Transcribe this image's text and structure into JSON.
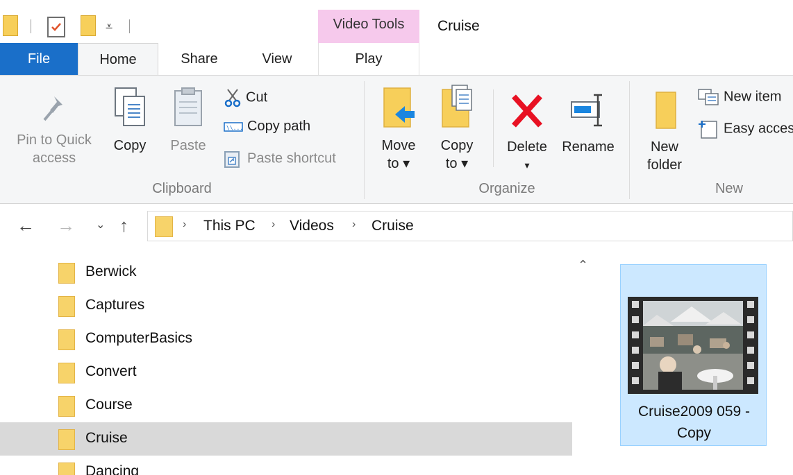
{
  "window": {
    "title": "Cruise",
    "contextual_tab_group": "Video Tools"
  },
  "tabs": {
    "file": "File",
    "home": "Home",
    "share": "Share",
    "view": "View",
    "play": "Play"
  },
  "ribbon": {
    "clipboard": {
      "label": "Clipboard",
      "pin_line1": "Pin to Quick",
      "pin_line2": "access",
      "copy": "Copy",
      "paste": "Paste",
      "cut": "Cut",
      "copy_path": "Copy path",
      "paste_shortcut": "Paste shortcut"
    },
    "organize": {
      "label": "Organize",
      "move_line1": "Move",
      "move_line2": "to ▾",
      "copyto_line1": "Copy",
      "copyto_line2": "to ▾",
      "delete": "Delete",
      "delete_arrow": "▾",
      "rename": "Rename"
    },
    "new": {
      "label": "New",
      "folder_line1": "New",
      "folder_line2": "folder",
      "new_item": "New item",
      "easy_access": "Easy access"
    }
  },
  "address": {
    "breadcrumbs": [
      "This PC",
      "Videos",
      "Cruise"
    ]
  },
  "nav_tree": {
    "items": [
      "Berwick",
      "Captures",
      "ComputerBasics",
      "Convert",
      "Course",
      "Cruise",
      "Dancing"
    ],
    "selected": "Cruise"
  },
  "files": [
    {
      "name_line1": "Cruise2009 059 -",
      "name_line2": "Copy",
      "type": "video"
    }
  ],
  "colors": {
    "file_tab": "#1a6fc9",
    "video_tools": "#f6c9ec",
    "folder": "#f7d36a",
    "selection": "#cce8ff",
    "delete_red": "#e81123"
  }
}
